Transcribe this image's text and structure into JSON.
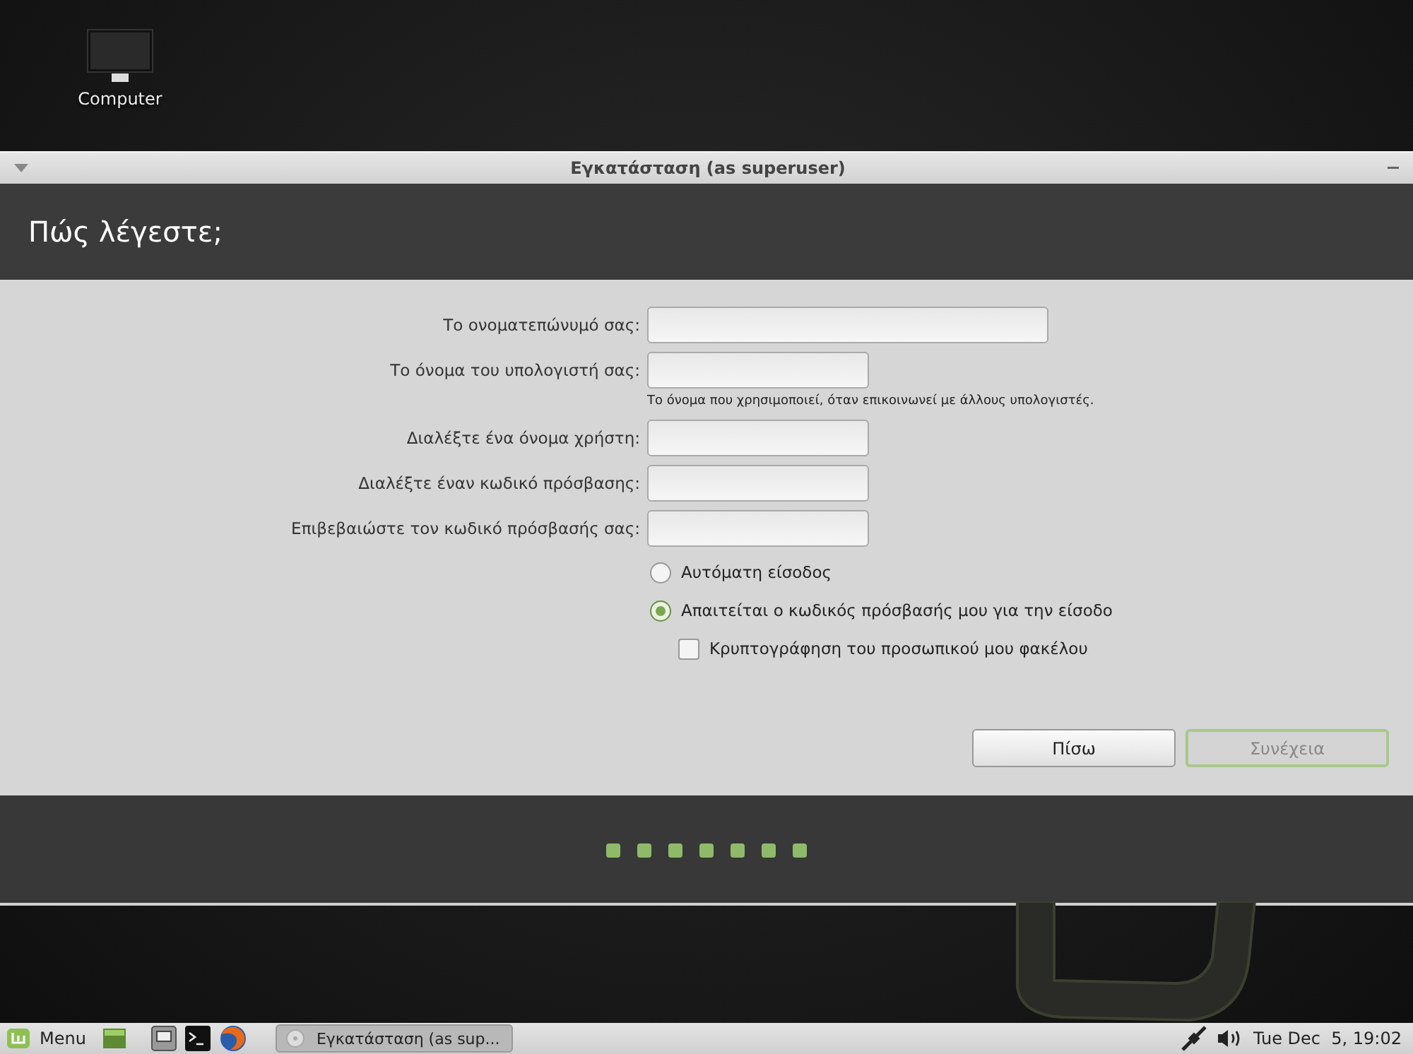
{
  "desktop": {
    "icons": [
      {
        "label": "Computer"
      }
    ]
  },
  "window": {
    "title": "Εγκατάσταση (as superuser)",
    "heading": "Πώς λέγεστε;",
    "fields": [
      {
        "label": "Το ονοματεπώνυμό σας:",
        "kind": "wide"
      },
      {
        "label": "Το όνομα του υπολογιστή σας:",
        "kind": "normal",
        "hint": "Το όνομα που χρησιμοποιεί, όταν επικοινωνεί με άλλους υπολογιστές."
      },
      {
        "label": "Διαλέξτε ένα όνομα χρήστη:",
        "kind": "normal"
      },
      {
        "label": "Διαλέξτε έναν κωδικό πρόσβασης:",
        "kind": "normal"
      },
      {
        "label": "Επιβεβαιώστε τον κωδικό πρόσβασής σας:",
        "kind": "normal"
      }
    ],
    "options": [
      {
        "kind": "radio",
        "label": "Αυτόματη είσοδος",
        "selected": false
      },
      {
        "kind": "radio",
        "label": "Απαιτείται ο κωδικός πρόσβασής μου για την είσοδο",
        "selected": true
      },
      {
        "kind": "checkbox",
        "label": "Κρυπτογράφηση του προσωπικού μου φακέλου",
        "checked": false
      }
    ],
    "buttons": [
      {
        "label": "Πίσω",
        "disabled": false
      },
      {
        "label": "Συνέχεια",
        "disabled": true
      }
    ]
  },
  "taskbar": {
    "menu_label": "Menu",
    "window_button": "Εγκατάσταση (as sup...",
    "clock": "Tue Dec  5, 19:02"
  }
}
